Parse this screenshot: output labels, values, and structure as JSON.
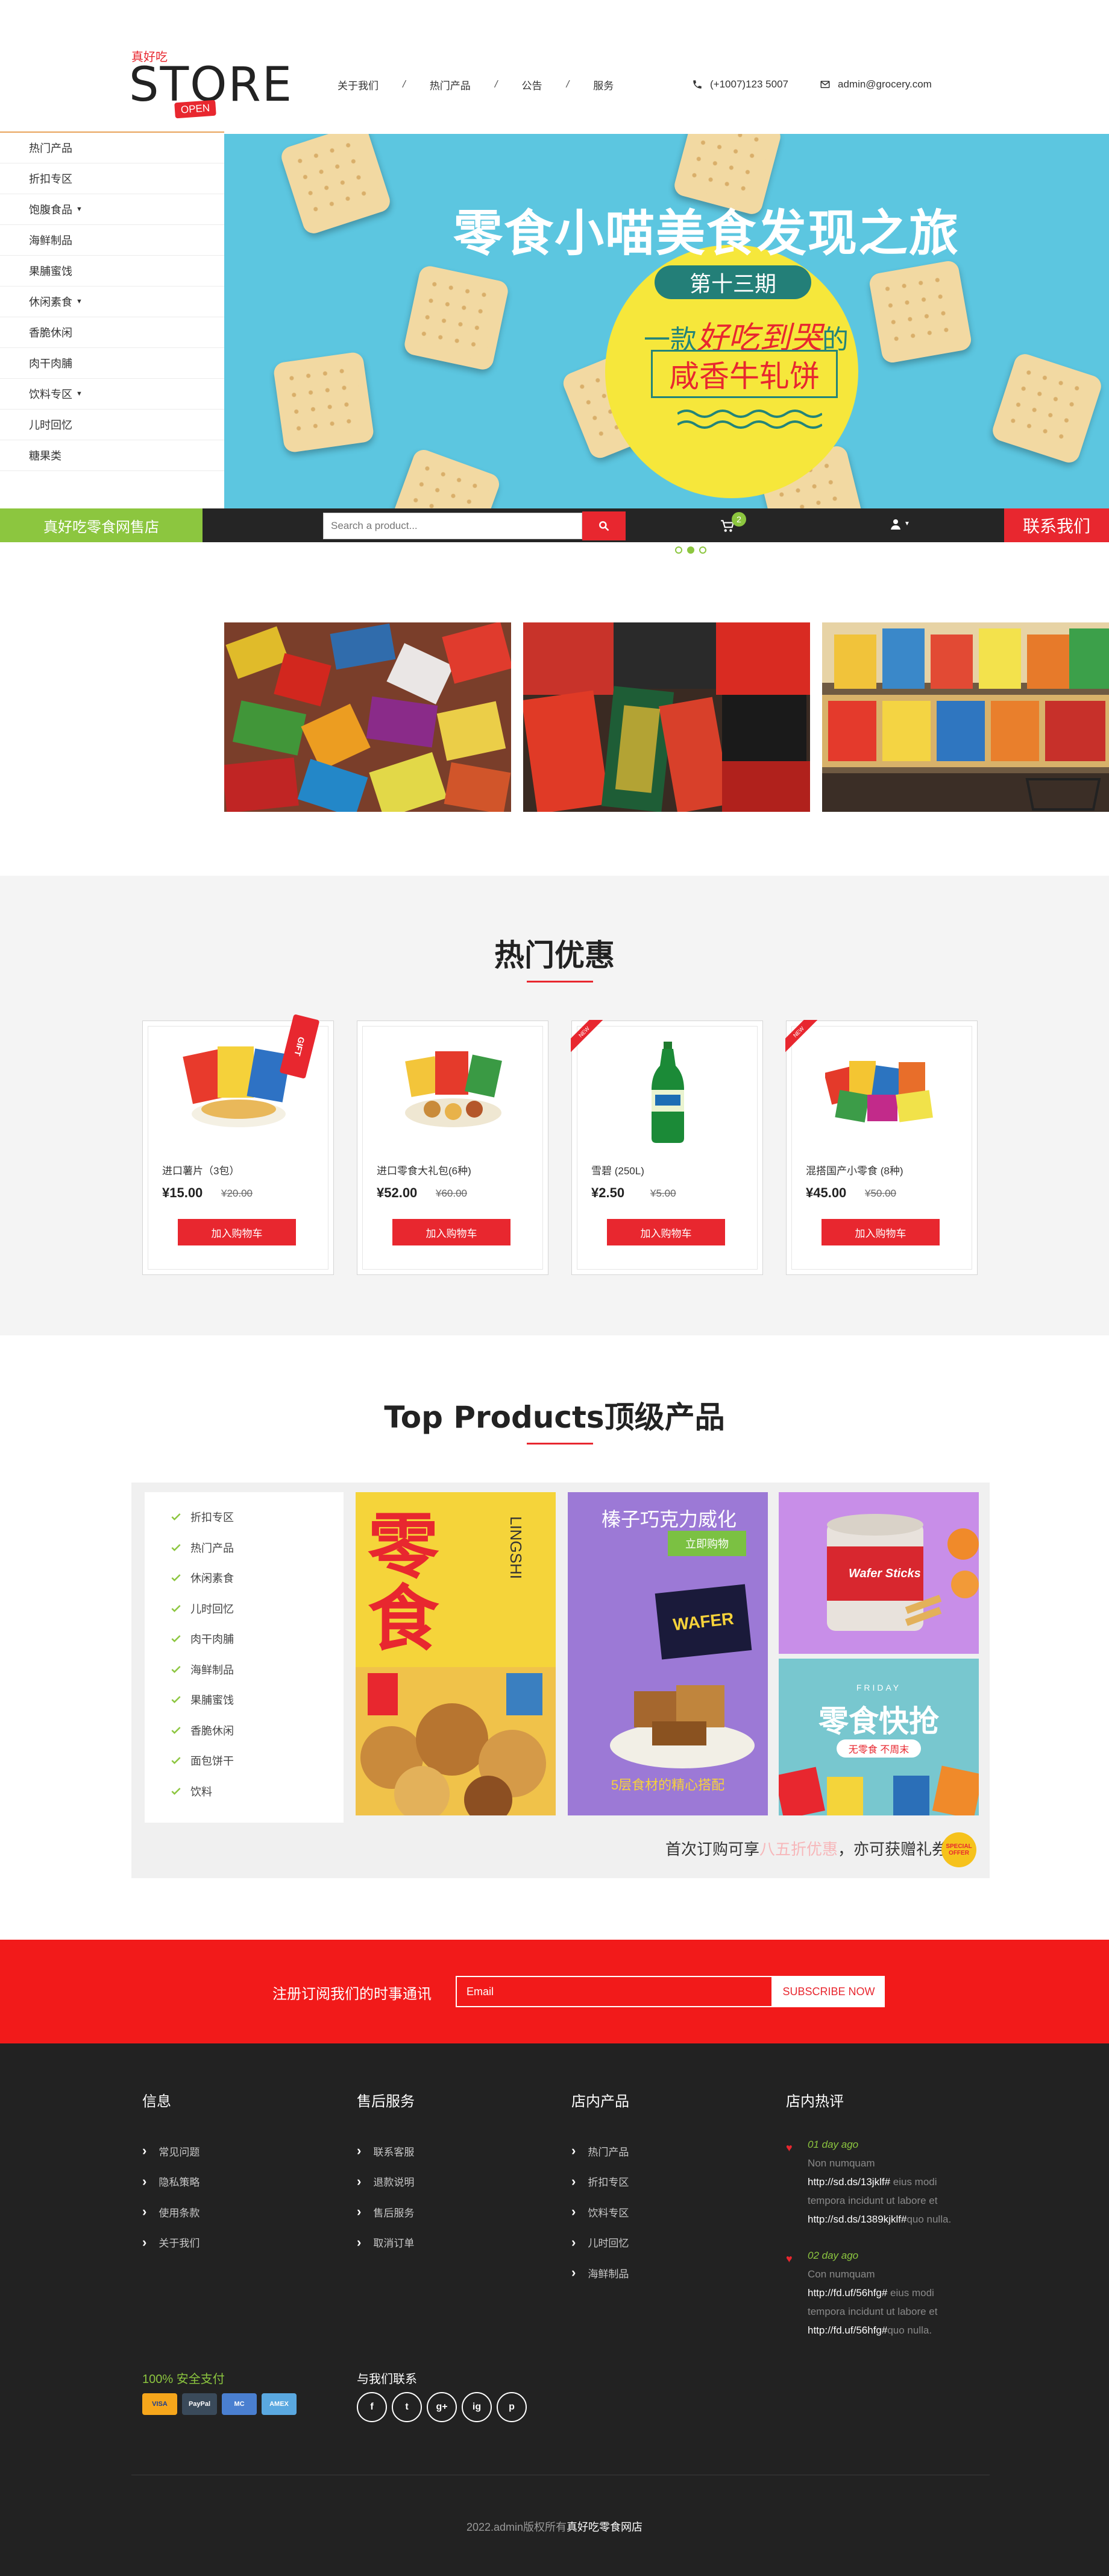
{
  "header": {
    "logo_top": "真好吃",
    "logo_word": "STORE",
    "logo_badge": "OPEN",
    "nav": [
      "关于我们",
      "热门产品",
      "公告",
      "服务"
    ],
    "nav_separator": "/",
    "phone": "(+1007)123 5007",
    "email": "admin@grocery.com"
  },
  "categories": [
    {
      "label": "热门产品",
      "dropdown": false
    },
    {
      "label": "折扣专区",
      "dropdown": false
    },
    {
      "label": "饱腹食品",
      "dropdown": true
    },
    {
      "label": "海鲜制品",
      "dropdown": false
    },
    {
      "label": "果脯蜜饯",
      "dropdown": false
    },
    {
      "label": "休闲素食",
      "dropdown": true
    },
    {
      "label": "香脆休闲",
      "dropdown": false
    },
    {
      "label": "肉干肉脯",
      "dropdown": false
    },
    {
      "label": "饮料专区",
      "dropdown": true
    },
    {
      "label": "儿时回忆",
      "dropdown": false
    },
    {
      "label": "糖果类",
      "dropdown": false
    }
  ],
  "banner": {
    "title": "零食小喵美食发现之旅",
    "issue": "第十三期",
    "slogan_pre": "一款",
    "slogan_em": "好吃到哭",
    "slogan_post": "的",
    "product": "咸香牛轧饼"
  },
  "shopbar": {
    "shop_name": "真好吃零食网售店",
    "search_placeholder": "Search a product...",
    "cart_count": "2",
    "contact_us": "联系我们"
  },
  "carousel": {
    "dots": 3,
    "active": 1
  },
  "hot_deals": {
    "title": "热门优惠",
    "products": [
      {
        "name": "进口薯片（3包）",
        "price": "¥15.00",
        "old_price": "¥20.00",
        "button": "加入购物车",
        "tag": "gift"
      },
      {
        "name": "进口零食大礼包(6种)",
        "price": "¥52.00",
        "old_price": "¥60.00",
        "button": "加入购物车",
        "tag": "none"
      },
      {
        "name": "雪碧 (250L)",
        "price": "¥2.50",
        "old_price": "¥5.00",
        "button": "加入购物车",
        "tag": "ribbon"
      },
      {
        "name": "混搭国产小零食 (8种)",
        "price": "¥45.00",
        "old_price": "¥50.00",
        "button": "加入购物车",
        "tag": "ribbon"
      }
    ],
    "gift_label": "GIFT",
    "ribbon_label": "NEW"
  },
  "top_products": {
    "title": "Top Products顶级产品",
    "list": [
      "折扣专区",
      "热门产品",
      "休闲素食",
      "儿时回忆",
      "肉干肉脯",
      "海鲜制品",
      "果脯蜜饯",
      "香脆休闲",
      "面包饼干",
      "饮料"
    ],
    "poster1_title": "零食",
    "poster1_side": "LINGSHI",
    "poster2_title": "榛子巧克力威化",
    "poster2_btn": "立即购物",
    "poster2_brand": "WAFER",
    "poster2_footer": "5层食材的精心搭配",
    "poster3_brand": "Wafer Sticks",
    "poster4_title": "零食快抢",
    "poster4_sub": "无零食 不周末",
    "poster4_friday": "FRIDAY",
    "promo_pre": "首次订购可享",
    "promo_hl": "八五折优惠",
    "promo_post": "，亦可获赠礼券",
    "special": "SPECIAL OFFER"
  },
  "subscribe": {
    "label": "注册订阅我们的时事通讯",
    "placeholder": "Email",
    "button": "SUBSCRIBE NOW"
  },
  "footer": {
    "columns": [
      {
        "title": "信息",
        "links": [
          "常见问题",
          "隐私策略",
          "使用条款",
          "关于我们"
        ]
      },
      {
        "title": "售后服务",
        "links": [
          "联系客服",
          "退款说明",
          "售后服务",
          "取消订单"
        ]
      },
      {
        "title": "店内产品",
        "links": [
          "热门产品",
          "折扣专区",
          "饮料专区",
          "儿时回忆",
          "海鲜制品"
        ]
      }
    ],
    "tweets_title": "店内热评",
    "tweets": [
      {
        "date": "01 day ago",
        "line1": "Non numquam",
        "link1": "http://sd.ds/13jklf#",
        "text1": " eius modi",
        "line3": "tempora incidunt ut labore et",
        "link2": "http://sd.ds/1389kjklf#",
        "text2": "quo nulla."
      },
      {
        "date": "02 day ago",
        "line1": "Con numquam",
        "link1": "http://fd.uf/56hfg#",
        "text1": " eius modi",
        "line3": "tempora incidunt ut labore et",
        "link2": "http://fd.uf/56hfg#",
        "text2": "quo nulla."
      }
    ],
    "payment_title": "100% 安全支付",
    "payment_cards": [
      "VISA",
      "PayPal",
      "MC",
      "AMEX"
    ],
    "social_title": "与我们联系",
    "socials": [
      "f",
      "t",
      "g+",
      "ig",
      "p"
    ],
    "copyright_pre": "2022.admin版权所有",
    "copyright_store": "真好吃零食网店"
  },
  "colors": {
    "accent_red": "#e8272f",
    "accent_green": "#8cc63f",
    "banner_blue": "#5cc6e0",
    "footer_bg": "#222222"
  }
}
